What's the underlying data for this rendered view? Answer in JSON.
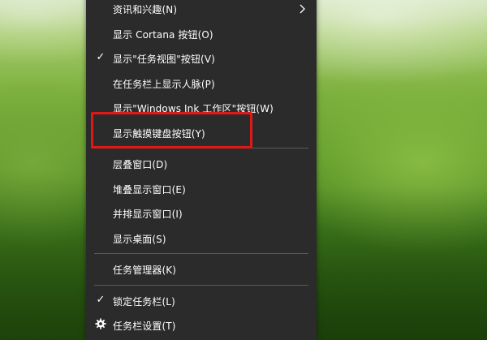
{
  "menu": {
    "items": [
      {
        "label": "资讯和兴趣(N)"
      },
      {
        "label": "显示 Cortana 按钮(O)"
      },
      {
        "label": "显示\"任务视图\"按钮(V)",
        "checked": true
      },
      {
        "label": "在任务栏上显示人脉(P)"
      },
      {
        "label": "显示\"Windows Ink 工作区\"按钮(W)"
      },
      {
        "label": "显示触摸键盘按钮(Y)",
        "highlighted": true
      },
      {
        "label": "层叠窗口(D)"
      },
      {
        "label": "堆叠显示窗口(E)"
      },
      {
        "label": "并排显示窗口(I)"
      },
      {
        "label": "显示桌面(S)"
      },
      {
        "label": "任务管理器(K)"
      },
      {
        "label": "锁定任务栏(L)",
        "checked": true
      },
      {
        "label": "任务栏设置(T)",
        "icon": "gear-icon"
      }
    ]
  },
  "icons": {
    "check": "✓",
    "submenu": "chevron-right-icon",
    "settings": "gear-icon"
  },
  "colors": {
    "menu_background": "#2b2b2b",
    "menu_text": "#ffffff",
    "separator": "#5c5c5c",
    "highlight_border": "#e01818"
  }
}
